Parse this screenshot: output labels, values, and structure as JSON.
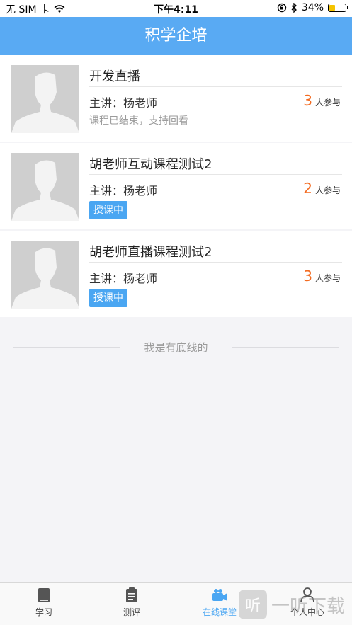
{
  "status_bar": {
    "carrier": "无 SIM 卡",
    "time": "下午4:11",
    "battery": "34%"
  },
  "header": {
    "title": "积学企培"
  },
  "courses": [
    {
      "title": "开发直播",
      "teacher": "主讲：杨老师",
      "count": "3",
      "count_suffix": "人参与",
      "status": "课程已结束，支持回看"
    },
    {
      "title": "胡老师互动课程测试2",
      "teacher": "主讲：杨老师",
      "count": "2",
      "count_suffix": "人参与",
      "badge": "授课中"
    },
    {
      "title": "胡老师直播课程测试2",
      "teacher": "主讲：杨老师",
      "count": "3",
      "count_suffix": "人参与",
      "badge": "授课中"
    }
  ],
  "footer_note": "我是有底线的",
  "tabs": [
    {
      "label": "学习",
      "icon": "book-icon"
    },
    {
      "label": "测评",
      "icon": "clipboard-icon"
    },
    {
      "label": "在线课堂",
      "icon": "video-camera-icon"
    },
    {
      "label": "个人中心",
      "icon": "user-icon"
    }
  ],
  "active_tab": "在线课堂",
  "watermark": "一听下载",
  "colors": {
    "accent": "#59aaf3",
    "badge": "#4aa6f2",
    "count": "#f36b21"
  }
}
